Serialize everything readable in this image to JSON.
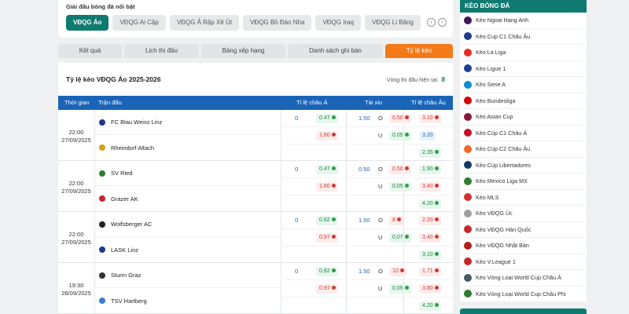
{
  "featured": {
    "title": "Giải đấu bóng đá nổi bật",
    "leagues": [
      "VĐQG Áo",
      "VĐQG Ai Cập",
      "VĐQG Ả Rập Xê Út",
      "VĐQG Bồ Đào Nha",
      "VĐQG Iraq",
      "VĐQG Li Băng"
    ],
    "prev_icon": "chevron-left-icon",
    "next_icon": "chevron-right-icon"
  },
  "tabs": [
    "Kết quả",
    "Lịch thi đấu",
    "Bảng xếp hạng",
    "Danh sách ghi bàn",
    "Tỷ lệ kèo"
  ],
  "active_tab": "Tỷ lệ kèo",
  "main": {
    "title": "Tỷ lệ kèo VĐQG Áo 2025-2026",
    "round_label": "Vòng thi đấu hiện tại:",
    "round_value": "8",
    "columns": [
      "Thời gian",
      "Trận đấu",
      "Tỉ lệ châu Á",
      "Tài xỉu",
      "Tỉ lệ châu Âu"
    ]
  },
  "matches": [
    {
      "time": "22:00",
      "date": "27/09/2025",
      "home": "FC Blau Weiss Linz",
      "away": "Rheindorf Altach",
      "ah_line": "0",
      "ah_home": "0.47",
      "ah_away": "1.60",
      "ou_line": "1.50",
      "ou_over_label": "O",
      "ou_over": "0.50",
      "ou_under_label": "U",
      "ou_under": "0.05",
      "eu_home": "3.10",
      "eu_draw": "3.20",
      "eu_away": "2.35"
    },
    {
      "time": "22:00",
      "date": "27/09/2025",
      "home": "SV Ried",
      "away": "Grazer AK",
      "ah_line": "0",
      "ah_home": "0.47",
      "ah_away": "1.60",
      "ou_line": "0.50",
      "ou_over_label": "O",
      "ou_over": "0.50",
      "ou_under_label": "U",
      "ou_under": "0.05",
      "eu_home": "1.90",
      "eu_draw": "3.40",
      "eu_away": "4.20"
    },
    {
      "time": "22:00",
      "date": "27/09/2025",
      "home": "Wolfsberger AC",
      "away": "LASK Linz",
      "ah_line": "0",
      "ah_home": "0.82",
      "ah_away": "0.97",
      "ou_line": "1.50",
      "ou_over_label": "O",
      "ou_over": "8",
      "ou_under_label": "U",
      "ou_under": "0.07",
      "eu_home": "2.20",
      "eu_draw": "3.40",
      "eu_away": "3.10"
    },
    {
      "time": "19:30",
      "date": "28/09/2025",
      "home": "Sturm Graz",
      "away": "TSV Hartberg",
      "ah_line": "0",
      "ah_home": "0.82",
      "ah_away": "0.97",
      "ou_line": "1.50",
      "ou_over_label": "O",
      "ou_over": "10",
      "ou_under_label": "U",
      "ou_under": "0.05",
      "eu_home": "1.71",
      "eu_draw": "3.80",
      "eu_away": "4.20"
    }
  ],
  "sidebar": {
    "title": "Kèo bóng đá",
    "items": [
      "Kèo Ngoại Hạng Anh",
      "Kèo Cup C1 Châu Âu",
      "Kèo La Liga",
      "Kèo Ligue 1",
      "Kèo Serie A",
      "Kèo Bundesliga",
      "Kèo Asian Cup",
      "Kèo Cúp C1 Châu Á",
      "Kèo Cúp C2 Châu Âu",
      "Kèo Cúp Libertadores",
      "Kèo Mexico Liga MX",
      "Kèo MLS",
      "Kèo VĐQG Úc",
      "Kèo VĐQG Hàn Quốc",
      "Kèo VĐQG Nhật Bản",
      "Kèo V.League 1",
      "Kèo Vòng Loại World Cup Châu Á",
      "Kèo Vòng Loại World Cup Châu Phi"
    ],
    "icon_colors": [
      "#3d195b",
      "#1a3c8c",
      "#ee2a24",
      "#1c3f94",
      "#0a8cd2",
      "#d3010c",
      "#8a1538",
      "#c8102e",
      "#f26522",
      "#0d3b66",
      "#2e7d32",
      "#d32f2f",
      "#9e9e9e",
      "#c62828",
      "#b71c1c",
      "#c62828",
      "#455a64",
      "#2e7d32"
    ]
  },
  "colors": {
    "brand": "#0f7a70",
    "header_blue": "#1a64b8",
    "active_tab": "#f47a17",
    "positive": "#1a8a3a",
    "negative": "#d23a2f"
  }
}
